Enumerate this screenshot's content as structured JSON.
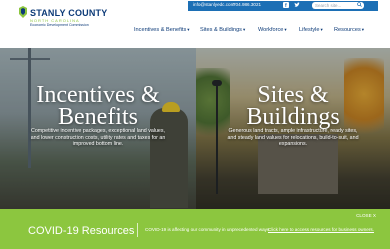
{
  "topbar": {
    "email": "info@stanlyedc.com",
    "phone": "704.986.3021",
    "facebook_icon": "facebook-icon",
    "twitter_icon": "twitter-icon",
    "search_placeholder": "Search site...",
    "search_icon": "search-icon",
    "accent_color": "#1c6fb5"
  },
  "logo": {
    "title": "STANLY COUNTY",
    "subtitle": "NORTH CAROLINA",
    "tagline": "Economic Development Commission"
  },
  "nav": {
    "items": [
      {
        "label": "Incentives & Benefits"
      },
      {
        "label": "Sites & Buildings"
      },
      {
        "label": "Workforce"
      },
      {
        "label": "Lifestyle"
      },
      {
        "label": "Resources"
      }
    ],
    "chevron_icon": "chevron-down-icon",
    "text_color": "#0d3b78"
  },
  "hero": {
    "left": {
      "title_line1": "Incentives &",
      "title_line2": "Benefits",
      "description": "Competitive incentive packages, exceptional land values, and lower construction costs, utility rates and taxes for an improved bottom line."
    },
    "right": {
      "title_line1": "Sites &",
      "title_line2": "Buildings",
      "description": "Generous land tracts, ample infrastructure, ready sites, and steady land values for relocations, build-to-suit, and expansions."
    }
  },
  "covid": {
    "close_label": "CLOSE X",
    "title": "COVID-19 Resources",
    "text": "COVID-19 is affecting our community in unprecedented ways.",
    "link": "Click here to access resources for business owners.",
    "background_color": "#8cc63f"
  }
}
